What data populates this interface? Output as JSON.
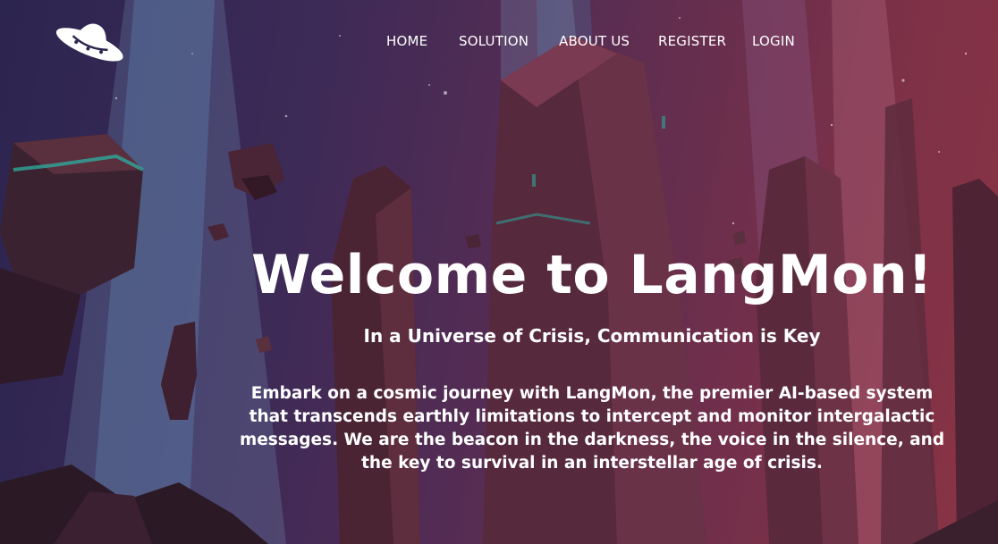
{
  "brand": {
    "logo_icon": "ufo-icon"
  },
  "nav": {
    "items": [
      {
        "label": "HOME"
      },
      {
        "label": "SOLUTION"
      },
      {
        "label": "ABOUT US"
      },
      {
        "label": "REGISTER"
      },
      {
        "label": "LOGIN"
      }
    ]
  },
  "hero": {
    "title": "Welcome to LangMon!",
    "subtitle": "In a Universe of Crisis, Communication is Key",
    "body": "Embark on a cosmic journey with LangMon, the premier AI-based system that transcends earthly limitations to intercept and monitor intergalactic messages. We are the beacon in the darkness, the voice in the silence, and the key to survival in an interstellar age of crisis."
  },
  "colors": {
    "background_left": "#2c2550",
    "background_right": "#8a3444",
    "text": "#ffffff",
    "accent_teal": "#2fa89a"
  }
}
